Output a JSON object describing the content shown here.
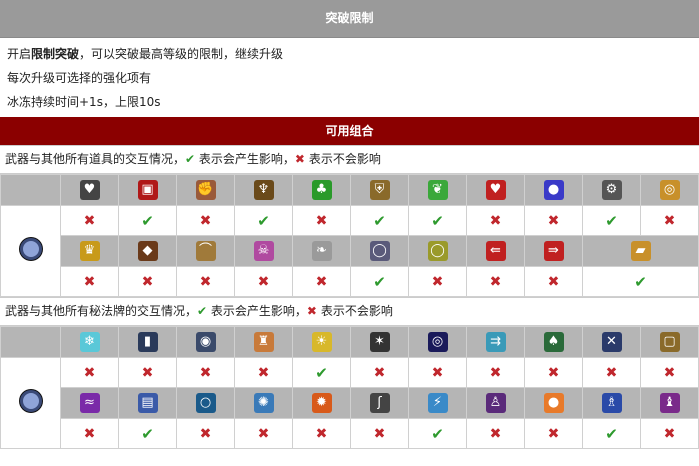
{
  "section_title": "突破限制",
  "line1_pre": "开启",
  "line1_bold": "限制突破",
  "line1_post": "，可以突破最高等级的限制，继续升级",
  "line2": "每次升级可选择的强化项有",
  "line3": "冰冻持续时间+1s，上限10s",
  "combo_title": "可用组合",
  "items_note": {
    "pre": "武器与其他所有道具的交互情况，",
    "ok_text": "表示会产生影响，",
    "no_text": "表示不会影响"
  },
  "cards_note": {
    "pre": "武器与其他所有秘法牌的交互情况，",
    "ok_text": "表示会产生影响，",
    "no_text": "表示不会影响"
  },
  "marks": {
    "ok": "✔",
    "no": "✖"
  },
  "items_row1_icons": [
    {
      "icon": "heart-helmet-icon",
      "glyph": "♥",
      "color": "#444"
    },
    {
      "icon": "red-book-icon",
      "glyph": "▣",
      "color": "#b01818"
    },
    {
      "icon": "gauntlet-icon",
      "glyph": "✊",
      "color": "#9a5a3a"
    },
    {
      "icon": "candelabra-icon",
      "glyph": "♆",
      "color": "#6a4a1a"
    },
    {
      "icon": "clover-icon",
      "glyph": "♣",
      "color": "#2a9a2a"
    },
    {
      "icon": "armor-icon",
      "glyph": "⛨",
      "color": "#8a6a2a"
    },
    {
      "icon": "feather-icon",
      "glyph": "❦",
      "color": "#3aa83a"
    },
    {
      "icon": "heart-icon",
      "glyph": "♥",
      "color": "#c02020"
    },
    {
      "icon": "blue-orb-icon",
      "glyph": "●",
      "color": "#3a3ac8"
    },
    {
      "icon": "gear-icon",
      "glyph": "⚙",
      "color": "#555"
    },
    {
      "icon": "ring-icon",
      "glyph": "◎",
      "color": "#c8902a"
    }
  ],
  "items_row1_marks": [
    "no",
    "ok",
    "no",
    "ok",
    "no",
    "ok",
    "ok",
    "no",
    "no",
    "ok",
    "no"
  ],
  "items_row2_icons": [
    {
      "icon": "crown-icon",
      "glyph": "♛",
      "color": "#c89a1a"
    },
    {
      "icon": "cake-icon",
      "glyph": "◆",
      "color": "#6a3a1a"
    },
    {
      "icon": "helmet-icon",
      "glyph": "⌒",
      "color": "#a07a3a"
    },
    {
      "icon": "skull-icon",
      "glyph": "☠",
      "color": "#b04aa0"
    },
    {
      "icon": "wing-icon",
      "glyph": "❧",
      "color": "#9a9a9a"
    },
    {
      "icon": "gray-ring-icon",
      "glyph": "◯",
      "color": "#5a5a7a"
    },
    {
      "icon": "gold-ring-icon",
      "glyph": "◯",
      "color": "#9a9a2a"
    },
    {
      "icon": "red-arrow-left-icon",
      "glyph": "⇚",
      "color": "#c02020"
    },
    {
      "icon": "red-arrow-right-icon",
      "glyph": "⇛",
      "color": "#c02020"
    },
    {
      "icon": "gold-bar-icon",
      "glyph": "▰",
      "color": "#c8902a"
    }
  ],
  "items_row2_marks": [
    "no",
    "no",
    "no",
    "no",
    "no",
    "ok",
    "no",
    "no",
    "no",
    "ok"
  ],
  "cards_row1_icons": [
    {
      "icon": "ice-card-icon",
      "glyph": "❄",
      "color": "#5ac8d8"
    },
    {
      "icon": "dark-card-icon",
      "glyph": "▮",
      "color": "#2a3a5a"
    },
    {
      "icon": "eye-card-icon",
      "glyph": "◉",
      "color": "#3a4a6a"
    },
    {
      "icon": "candle-card-icon",
      "glyph": "♜",
      "color": "#c87a3a"
    },
    {
      "icon": "sun-card-icon",
      "glyph": "☀",
      "color": "#d8b82a"
    },
    {
      "icon": "shatter-card-icon",
      "glyph": "✶",
      "color": "#333"
    },
    {
      "icon": "spiral-card-icon",
      "glyph": "◎",
      "color": "#1a1a5a"
    },
    {
      "icon": "arrows-card-icon",
      "glyph": "⇉",
      "color": "#3a9ab8"
    },
    {
      "icon": "palm-card-icon",
      "glyph": "♠",
      "color": "#2a6a3a"
    },
    {
      "icon": "cross-card-icon",
      "glyph": "✕",
      "color": "#2a3a6a"
    },
    {
      "icon": "frame-card-icon",
      "glyph": "▢",
      "color": "#8a6a2a"
    }
  ],
  "cards_row1_marks": [
    "no",
    "no",
    "no",
    "no",
    "ok",
    "no",
    "no",
    "no",
    "no",
    "no",
    "no"
  ],
  "cards_row2_icons": [
    {
      "icon": "wave-card-icon",
      "glyph": "≈",
      "color": "#7a2aa8"
    },
    {
      "icon": "book-card-icon",
      "glyph": "▤",
      "color": "#3a5aa8"
    },
    {
      "icon": "circle-card-icon",
      "glyph": "○",
      "color": "#1a5a8a"
    },
    {
      "icon": "sigil-card-icon",
      "glyph": "✺",
      "color": "#3a7ab8"
    },
    {
      "icon": "fire-card-icon",
      "glyph": "✹",
      "color": "#d85a1a"
    },
    {
      "icon": "hook-card-icon",
      "glyph": "ʃ",
      "color": "#444"
    },
    {
      "icon": "lightning-card-icon",
      "glyph": "⚡",
      "color": "#3a8ac8"
    },
    {
      "icon": "figure-card-icon",
      "glyph": "♙",
      "color": "#5a2a7a"
    },
    {
      "icon": "orange-orb-card-icon",
      "glyph": "●",
      "color": "#e87a2a"
    },
    {
      "icon": "blue-figure-card-icon",
      "glyph": "♗",
      "color": "#2a4aa8"
    },
    {
      "icon": "purple-card-icon",
      "glyph": "♝",
      "color": "#7a2a8a"
    }
  ],
  "cards_row2_marks": [
    "no",
    "ok",
    "no",
    "no",
    "no",
    "no",
    "ok",
    "no",
    "no",
    "ok",
    "no"
  ]
}
